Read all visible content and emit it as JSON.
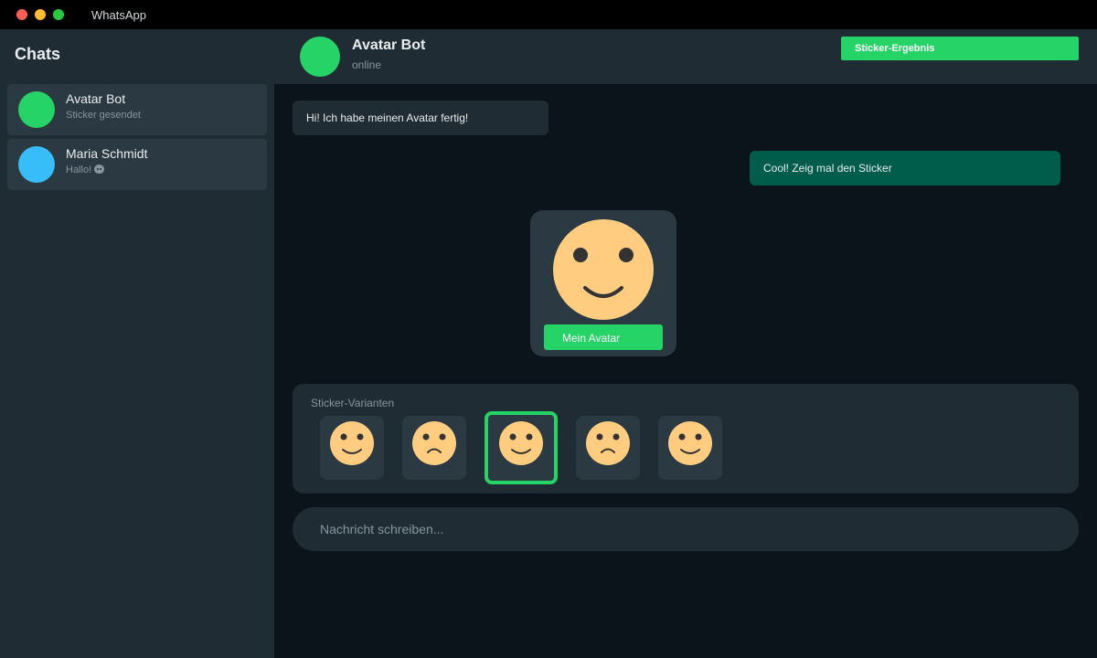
{
  "window": {
    "title": "WhatsApp"
  },
  "sidebar": {
    "title": "Chats",
    "chats": [
      {
        "name": "Avatar Bot",
        "preview": "Sticker gesendet",
        "avatar_color": "#25d366"
      },
      {
        "name": "Maria Schmidt",
        "preview": "Hallo!",
        "preview_icon": "emoji-face-icon",
        "avatar_color": "#38bdf8"
      }
    ]
  },
  "header": {
    "name": "Avatar Bot",
    "status": "online",
    "result_button": "Sticker-Ergebnis"
  },
  "messages": {
    "incoming": "Hi! Ich habe meinen Avatar fertig!",
    "outgoing": "Cool! Zeig mal den Sticker"
  },
  "sticker": {
    "caption": "Mein Avatar",
    "icon": "smiley-face-icon"
  },
  "variants": {
    "label": "Sticker-Varianten",
    "items": [
      {
        "icon": "smile-face-icon",
        "mood": "smile"
      },
      {
        "icon": "sad-face-icon",
        "mood": "sad"
      },
      {
        "icon": "smile-face-icon",
        "mood": "smile",
        "selected": true
      },
      {
        "icon": "sad-face-icon",
        "mood": "sad"
      },
      {
        "icon": "smile-face-icon",
        "mood": "smile"
      }
    ]
  },
  "compose": {
    "placeholder": "Nachricht schreiben...",
    "value": ""
  },
  "colors": {
    "accent": "#25d366",
    "outgoing_bubble": "#005c4b",
    "incoming_bubble": "#202c33",
    "face": "#ffcc80",
    "face_features": "#333333"
  }
}
